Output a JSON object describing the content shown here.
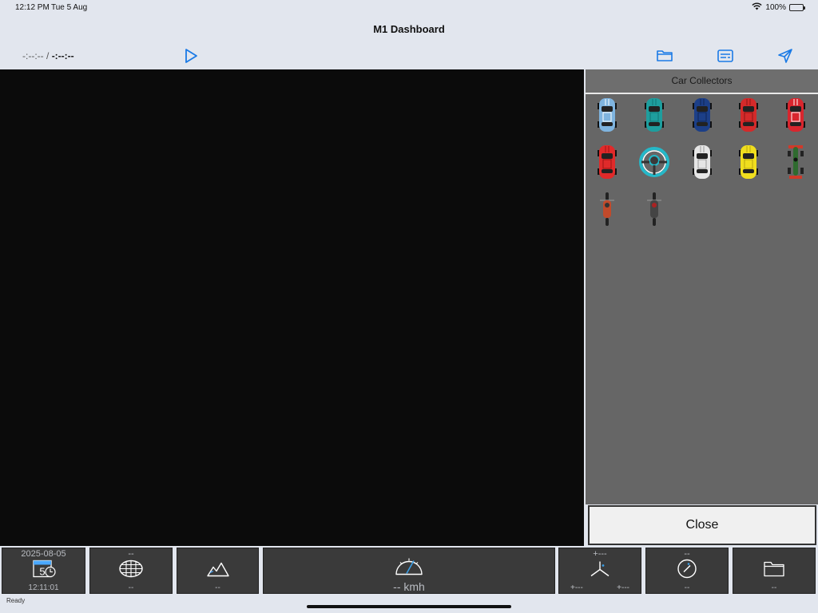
{
  "status": {
    "time": "12:12 PM",
    "date": "Tue 5 Aug",
    "battery": "100%"
  },
  "nav": {
    "title": "M1 Dashboard"
  },
  "toolbar": {
    "current_time": "-:--:--",
    "separator": "/",
    "total_time": "-:--:--"
  },
  "panel": {
    "title": "Car Collectors",
    "cars": [
      {
        "name": "Blue Mini",
        "body": "#7fb4df",
        "stripe": "#ffffff",
        "kind": "car"
      },
      {
        "name": "Teal SUV",
        "body": "#1e9e9e",
        "stripe": "#117777",
        "kind": "car"
      },
      {
        "name": "Blue Sedan",
        "body": "#1c3f88",
        "stripe": "#0f2655",
        "kind": "car"
      },
      {
        "name": "Red Roadster",
        "body": "#d42a2a",
        "stripe": "#8a1515",
        "kind": "car"
      },
      {
        "name": "Red Sports",
        "body": "#d8262e",
        "stripe": "#ffffff",
        "kind": "car"
      },
      {
        "name": "Red Coupe",
        "body": "#e02a2a",
        "stripe": "#9b1414",
        "kind": "car"
      },
      {
        "name": "Steering Wheel",
        "body": "#25b8c8",
        "stripe": "#ffffff",
        "kind": "wheel"
      },
      {
        "name": "White Porsche",
        "body": "#e6e6e6",
        "stripe": "#9a9a9a",
        "kind": "car"
      },
      {
        "name": "Yellow Roadster",
        "body": "#f0de1e",
        "stripe": "#b8a510",
        "kind": "car"
      },
      {
        "name": "Formula Car",
        "body": "#2f6b2f",
        "stripe": "#d03a2a",
        "kind": "f1"
      },
      {
        "name": "Red Motorbike",
        "body": "#c14a2b",
        "stripe": "#333333",
        "kind": "moto"
      },
      {
        "name": "Black Motorbike",
        "body": "#444444",
        "stripe": "#aa2222",
        "kind": "moto"
      }
    ]
  },
  "close_label": "Close",
  "tiles": {
    "date": {
      "top": "2025-08-05",
      "bottom": "12:11:01",
      "day": "5"
    },
    "map": {
      "top": "--",
      "bottom": "--"
    },
    "altitude": {
      "bottom": "--"
    },
    "speed": {
      "label": "-- kmh"
    },
    "gforce": {
      "top": "+---",
      "bottom_left": "+---",
      "bottom_right": "+---"
    },
    "compass": {
      "top": "--",
      "bottom": "--"
    },
    "folder": {
      "bottom": "--"
    }
  },
  "footer": {
    "status": "Ready"
  },
  "colors": {
    "accent": "#1a7ae6",
    "tile_bg": "#3a3a3a",
    "panel_bg": "#666666"
  }
}
